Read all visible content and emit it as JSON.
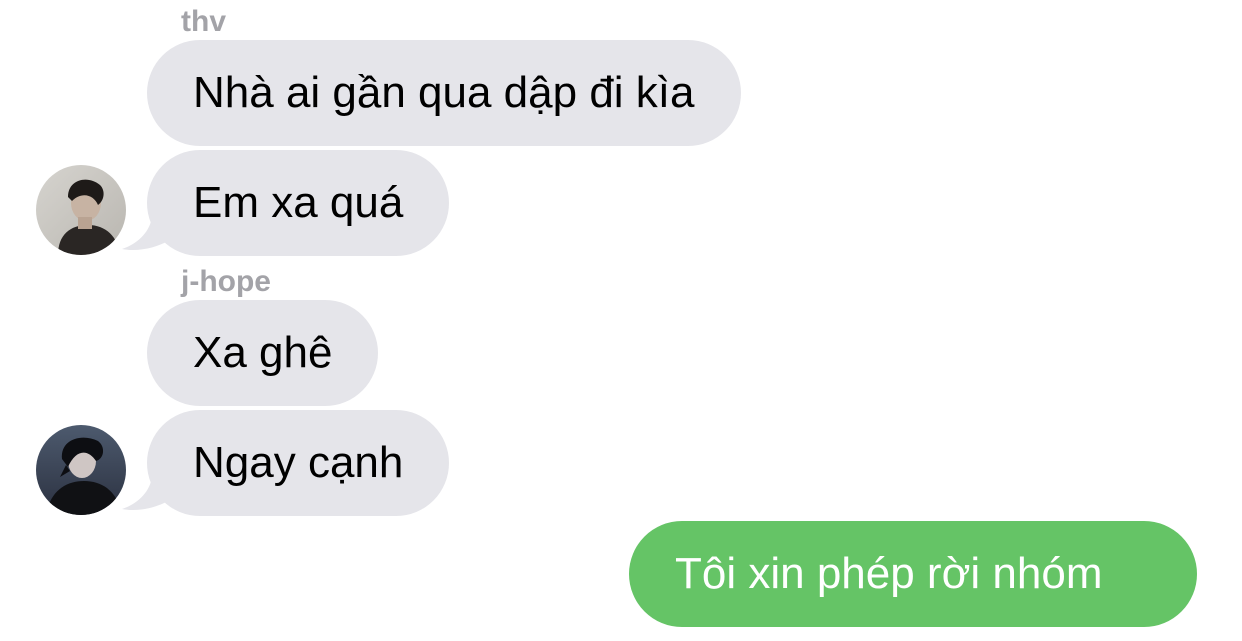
{
  "colors": {
    "incoming_bubble": "#e5e5ea",
    "outgoing_bubble": "#65c466",
    "sender_name": "#a3a3a8"
  },
  "messages": [
    {
      "sender": "thv",
      "text": "Nhà ai gần qua dập đi kìa"
    },
    {
      "text": "Em xa quá",
      "avatar": "thv-avatar"
    },
    {
      "sender": "j-hope",
      "text": "Xa ghê"
    },
    {
      "text": "Ngay cạnh",
      "avatar": "j-hope-avatar"
    },
    {
      "outgoing": true,
      "text": "Tôi xin phép rời nhóm"
    }
  ]
}
